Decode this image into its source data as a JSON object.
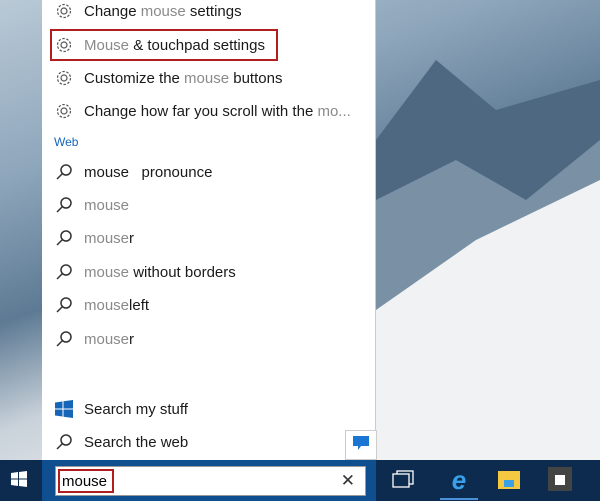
{
  "settings": [
    {
      "parts": [
        {
          "t": "Change ",
          "g": false
        },
        {
          "t": "mouse",
          "g": true
        },
        {
          "t": " settings",
          "g": false
        }
      ]
    },
    {
      "parts": [
        {
          "t": "Mouse",
          "g": true
        },
        {
          "t": " & touchpad settings",
          "g": false
        }
      ],
      "highlighted": true
    },
    {
      "parts": [
        {
          "t": "Customize the ",
          "g": false
        },
        {
          "t": "mouse",
          "g": true
        },
        {
          "t": " buttons",
          "g": false
        }
      ]
    },
    {
      "parts": [
        {
          "t": "Change how far you scroll with the ",
          "g": false
        },
        {
          "t": "mo...",
          "g": true
        }
      ]
    }
  ],
  "web_heading": "Web",
  "web": [
    {
      "parts": [
        {
          "t": "mouse   pronounce",
          "g": false
        }
      ]
    },
    {
      "parts": [
        {
          "t": "mouse",
          "g": true
        }
      ]
    },
    {
      "parts": [
        {
          "t": "mouse",
          "g": true
        },
        {
          "t": "r",
          "g": false
        }
      ]
    },
    {
      "parts": [
        {
          "t": "mouse",
          "g": true
        },
        {
          "t": " without borders",
          "g": false
        }
      ]
    },
    {
      "parts": [
        {
          "t": "mouse",
          "g": true
        },
        {
          "t": "left",
          "g": false
        }
      ]
    },
    {
      "parts": [
        {
          "t": "mouse",
          "g": true
        },
        {
          "t": "r",
          "g": false
        }
      ]
    }
  ],
  "search_my_stuff": "Search my stuff",
  "search_the_web": "Search the web",
  "search_box": {
    "value": "mouse"
  },
  "colors": {
    "accent": "#1565b8",
    "highlight": "#b01e1e",
    "taskbar": "#0c2b4e"
  }
}
